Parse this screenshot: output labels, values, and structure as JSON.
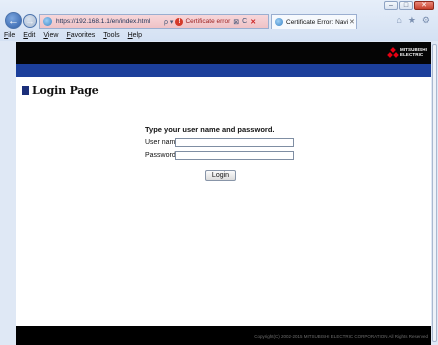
{
  "browser": {
    "window_controls": {
      "minimize": "–",
      "maximize": "□",
      "close": "✕"
    },
    "back_glyph": "←",
    "forward_glyph": "→",
    "address": {
      "url": "https://192.168.1.1/en/index.html",
      "search_glyph": "ρ ▾",
      "cert_icon": "!",
      "cert_error_label": "Certificate error",
      "compat_glyph": "⊠",
      "refresh_glyph": "C",
      "stop_glyph": "✕"
    },
    "tab": {
      "title": "Certificate Error: Navigation...",
      "close_glyph": "✕"
    },
    "tool_icons": {
      "home": "⌂",
      "favorites": "★",
      "settings": "⚙"
    },
    "menu": [
      "File",
      "Edit",
      "View",
      "Favorites",
      "Tools",
      "Help"
    ]
  },
  "header": {
    "logo_line1": "MITSUBISHI",
    "logo_line2": "ELECTRIC",
    "brand_color": "#e60012",
    "bar_color": "#1c3f9b"
  },
  "page": {
    "title": "Login Page",
    "instruction": "Type your user name and password.",
    "username_label": "User name",
    "username_value": "",
    "password_label": "Password",
    "password_value": "",
    "login_button": "Login"
  },
  "footer": {
    "copyright": "Copyright(C) 2002-2015 MITSUBISHI ELECTRIC CORPORATION All Rights Reserved"
  }
}
